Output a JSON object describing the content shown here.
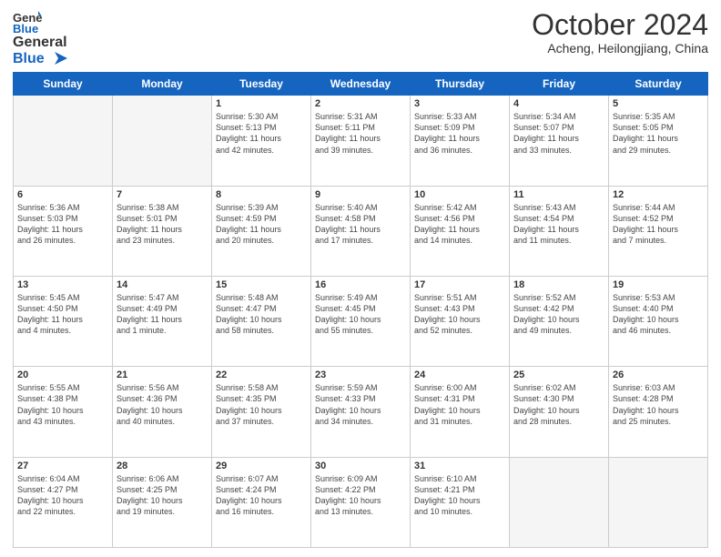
{
  "header": {
    "logo_general": "General",
    "logo_blue": "Blue",
    "month": "October 2024",
    "location": "Acheng, Heilongjiang, China"
  },
  "days_of_week": [
    "Sunday",
    "Monday",
    "Tuesday",
    "Wednesday",
    "Thursday",
    "Friday",
    "Saturday"
  ],
  "weeks": [
    [
      {
        "day": "",
        "empty": true
      },
      {
        "day": "",
        "empty": true
      },
      {
        "day": "1",
        "sunrise": "Sunrise: 5:30 AM",
        "sunset": "Sunset: 5:13 PM",
        "daylight": "Daylight: 11 hours and 42 minutes."
      },
      {
        "day": "2",
        "sunrise": "Sunrise: 5:31 AM",
        "sunset": "Sunset: 5:11 PM",
        "daylight": "Daylight: 11 hours and 39 minutes."
      },
      {
        "day": "3",
        "sunrise": "Sunrise: 5:33 AM",
        "sunset": "Sunset: 5:09 PM",
        "daylight": "Daylight: 11 hours and 36 minutes."
      },
      {
        "day": "4",
        "sunrise": "Sunrise: 5:34 AM",
        "sunset": "Sunset: 5:07 PM",
        "daylight": "Daylight: 11 hours and 33 minutes."
      },
      {
        "day": "5",
        "sunrise": "Sunrise: 5:35 AM",
        "sunset": "Sunset: 5:05 PM",
        "daylight": "Daylight: 11 hours and 29 minutes."
      }
    ],
    [
      {
        "day": "6",
        "sunrise": "Sunrise: 5:36 AM",
        "sunset": "Sunset: 5:03 PM",
        "daylight": "Daylight: 11 hours and 26 minutes."
      },
      {
        "day": "7",
        "sunrise": "Sunrise: 5:38 AM",
        "sunset": "Sunset: 5:01 PM",
        "daylight": "Daylight: 11 hours and 23 minutes."
      },
      {
        "day": "8",
        "sunrise": "Sunrise: 5:39 AM",
        "sunset": "Sunset: 4:59 PM",
        "daylight": "Daylight: 11 hours and 20 minutes."
      },
      {
        "day": "9",
        "sunrise": "Sunrise: 5:40 AM",
        "sunset": "Sunset: 4:58 PM",
        "daylight": "Daylight: 11 hours and 17 minutes."
      },
      {
        "day": "10",
        "sunrise": "Sunrise: 5:42 AM",
        "sunset": "Sunset: 4:56 PM",
        "daylight": "Daylight: 11 hours and 14 minutes."
      },
      {
        "day": "11",
        "sunrise": "Sunrise: 5:43 AM",
        "sunset": "Sunset: 4:54 PM",
        "daylight": "Daylight: 11 hours and 11 minutes."
      },
      {
        "day": "12",
        "sunrise": "Sunrise: 5:44 AM",
        "sunset": "Sunset: 4:52 PM",
        "daylight": "Daylight: 11 hours and 7 minutes."
      }
    ],
    [
      {
        "day": "13",
        "sunrise": "Sunrise: 5:45 AM",
        "sunset": "Sunset: 4:50 PM",
        "daylight": "Daylight: 11 hours and 4 minutes."
      },
      {
        "day": "14",
        "sunrise": "Sunrise: 5:47 AM",
        "sunset": "Sunset: 4:49 PM",
        "daylight": "Daylight: 11 hours and 1 minute."
      },
      {
        "day": "15",
        "sunrise": "Sunrise: 5:48 AM",
        "sunset": "Sunset: 4:47 PM",
        "daylight": "Daylight: 10 hours and 58 minutes."
      },
      {
        "day": "16",
        "sunrise": "Sunrise: 5:49 AM",
        "sunset": "Sunset: 4:45 PM",
        "daylight": "Daylight: 10 hours and 55 minutes."
      },
      {
        "day": "17",
        "sunrise": "Sunrise: 5:51 AM",
        "sunset": "Sunset: 4:43 PM",
        "daylight": "Daylight: 10 hours and 52 minutes."
      },
      {
        "day": "18",
        "sunrise": "Sunrise: 5:52 AM",
        "sunset": "Sunset: 4:42 PM",
        "daylight": "Daylight: 10 hours and 49 minutes."
      },
      {
        "day": "19",
        "sunrise": "Sunrise: 5:53 AM",
        "sunset": "Sunset: 4:40 PM",
        "daylight": "Daylight: 10 hours and 46 minutes."
      }
    ],
    [
      {
        "day": "20",
        "sunrise": "Sunrise: 5:55 AM",
        "sunset": "Sunset: 4:38 PM",
        "daylight": "Daylight: 10 hours and 43 minutes."
      },
      {
        "day": "21",
        "sunrise": "Sunrise: 5:56 AM",
        "sunset": "Sunset: 4:36 PM",
        "daylight": "Daylight: 10 hours and 40 minutes."
      },
      {
        "day": "22",
        "sunrise": "Sunrise: 5:58 AM",
        "sunset": "Sunset: 4:35 PM",
        "daylight": "Daylight: 10 hours and 37 minutes."
      },
      {
        "day": "23",
        "sunrise": "Sunrise: 5:59 AM",
        "sunset": "Sunset: 4:33 PM",
        "daylight": "Daylight: 10 hours and 34 minutes."
      },
      {
        "day": "24",
        "sunrise": "Sunrise: 6:00 AM",
        "sunset": "Sunset: 4:31 PM",
        "daylight": "Daylight: 10 hours and 31 minutes."
      },
      {
        "day": "25",
        "sunrise": "Sunrise: 6:02 AM",
        "sunset": "Sunset: 4:30 PM",
        "daylight": "Daylight: 10 hours and 28 minutes."
      },
      {
        "day": "26",
        "sunrise": "Sunrise: 6:03 AM",
        "sunset": "Sunset: 4:28 PM",
        "daylight": "Daylight: 10 hours and 25 minutes."
      }
    ],
    [
      {
        "day": "27",
        "sunrise": "Sunrise: 6:04 AM",
        "sunset": "Sunset: 4:27 PM",
        "daylight": "Daylight: 10 hours and 22 minutes."
      },
      {
        "day": "28",
        "sunrise": "Sunrise: 6:06 AM",
        "sunset": "Sunset: 4:25 PM",
        "daylight": "Daylight: 10 hours and 19 minutes."
      },
      {
        "day": "29",
        "sunrise": "Sunrise: 6:07 AM",
        "sunset": "Sunset: 4:24 PM",
        "daylight": "Daylight: 10 hours and 16 minutes."
      },
      {
        "day": "30",
        "sunrise": "Sunrise: 6:09 AM",
        "sunset": "Sunset: 4:22 PM",
        "daylight": "Daylight: 10 hours and 13 minutes."
      },
      {
        "day": "31",
        "sunrise": "Sunrise: 6:10 AM",
        "sunset": "Sunset: 4:21 PM",
        "daylight": "Daylight: 10 hours and 10 minutes."
      },
      {
        "day": "",
        "empty": true
      },
      {
        "day": "",
        "empty": true
      }
    ]
  ]
}
